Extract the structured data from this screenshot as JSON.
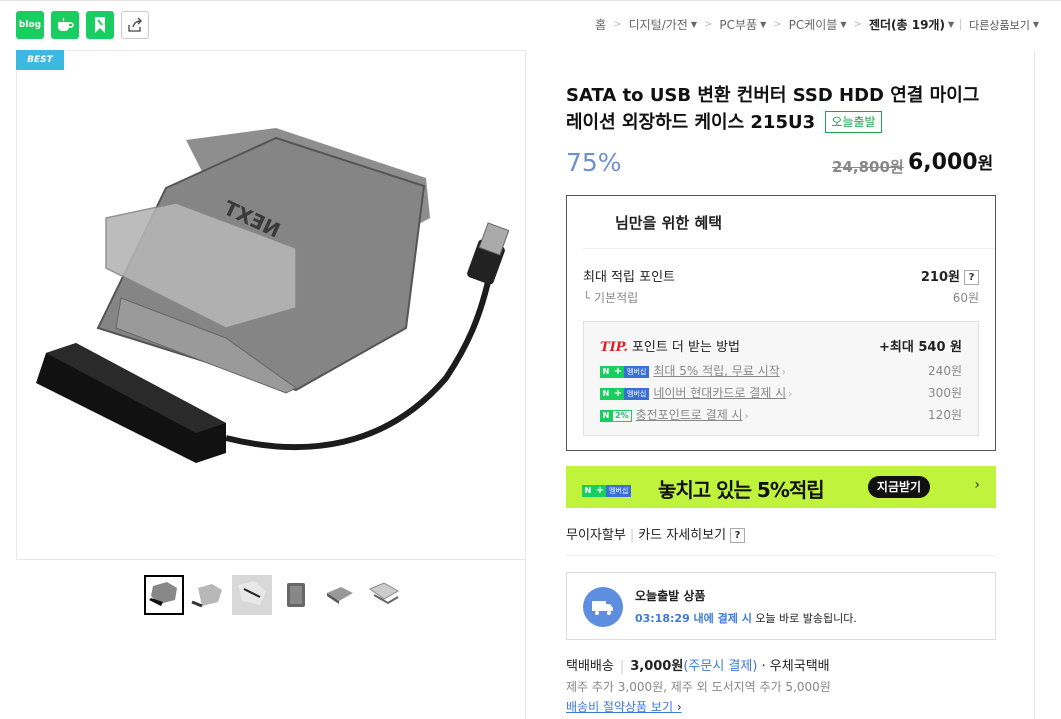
{
  "share": {
    "blog_label": "blog"
  },
  "breadcrumb": {
    "home": "홈",
    "cat1": "디지털/가전",
    "cat2": "PC부품",
    "cat3": "PC케이블",
    "current": "젠더(총 19개)",
    "other": "다른상품보기"
  },
  "badge": {
    "best": "BEST"
  },
  "product": {
    "title": "SATA to USB 변환 컨버터 SSD HDD 연결 마이그레이션 외장하드 케이스 215U3",
    "today_badge": "오늘출발",
    "discount": "75%",
    "original_price": "24,800원",
    "price": "6,000",
    "price_unit": "원"
  },
  "benefit": {
    "header": "님만을 위한 혜택",
    "max_point_label": "최대 적립 포인트",
    "max_point_value": "210원",
    "basic_label": "└ 기본적립",
    "basic_value": "60원",
    "tip_label": "TIP.",
    "tip_text": "포인트 더 받는 방법",
    "tip_max": "+최대 540 원",
    "items": [
      {
        "label": "최대 5% 적립, 무료 시작",
        "value": "240원"
      },
      {
        "label": "네이버 현대카드로 결제 시",
        "value": "300원"
      },
      {
        "label": "충전포인트로 결제 시",
        "value": "120원"
      }
    ],
    "membership": "멤버십",
    "pct": "2%"
  },
  "banner": {
    "text": "놓치고 있는 5%적립",
    "button": "지금받기",
    "arrow": "›"
  },
  "links": {
    "installment": "무이자할부",
    "card": "카드 자세히보기",
    "q": "?"
  },
  "shipping": {
    "title": "오늘출발 상품",
    "time": "03:18:29 내에 결제 시",
    "desc": "오늘 바로 발송됩니다."
  },
  "delivery": {
    "label": "택배배송",
    "fee": "3,000원",
    "note": "(주문시 결제)",
    "carrier": "· 우체국택배",
    "extra": "제주 추가 3,000원, 제주 외 도서지역 추가 5,000원",
    "saving_link": "배송비 절약상품 보기"
  },
  "colors": {
    "green": "#19ce60",
    "blue": "#3d7ae0",
    "lime": "#c0f43c",
    "discount": "#6f8fcf"
  }
}
